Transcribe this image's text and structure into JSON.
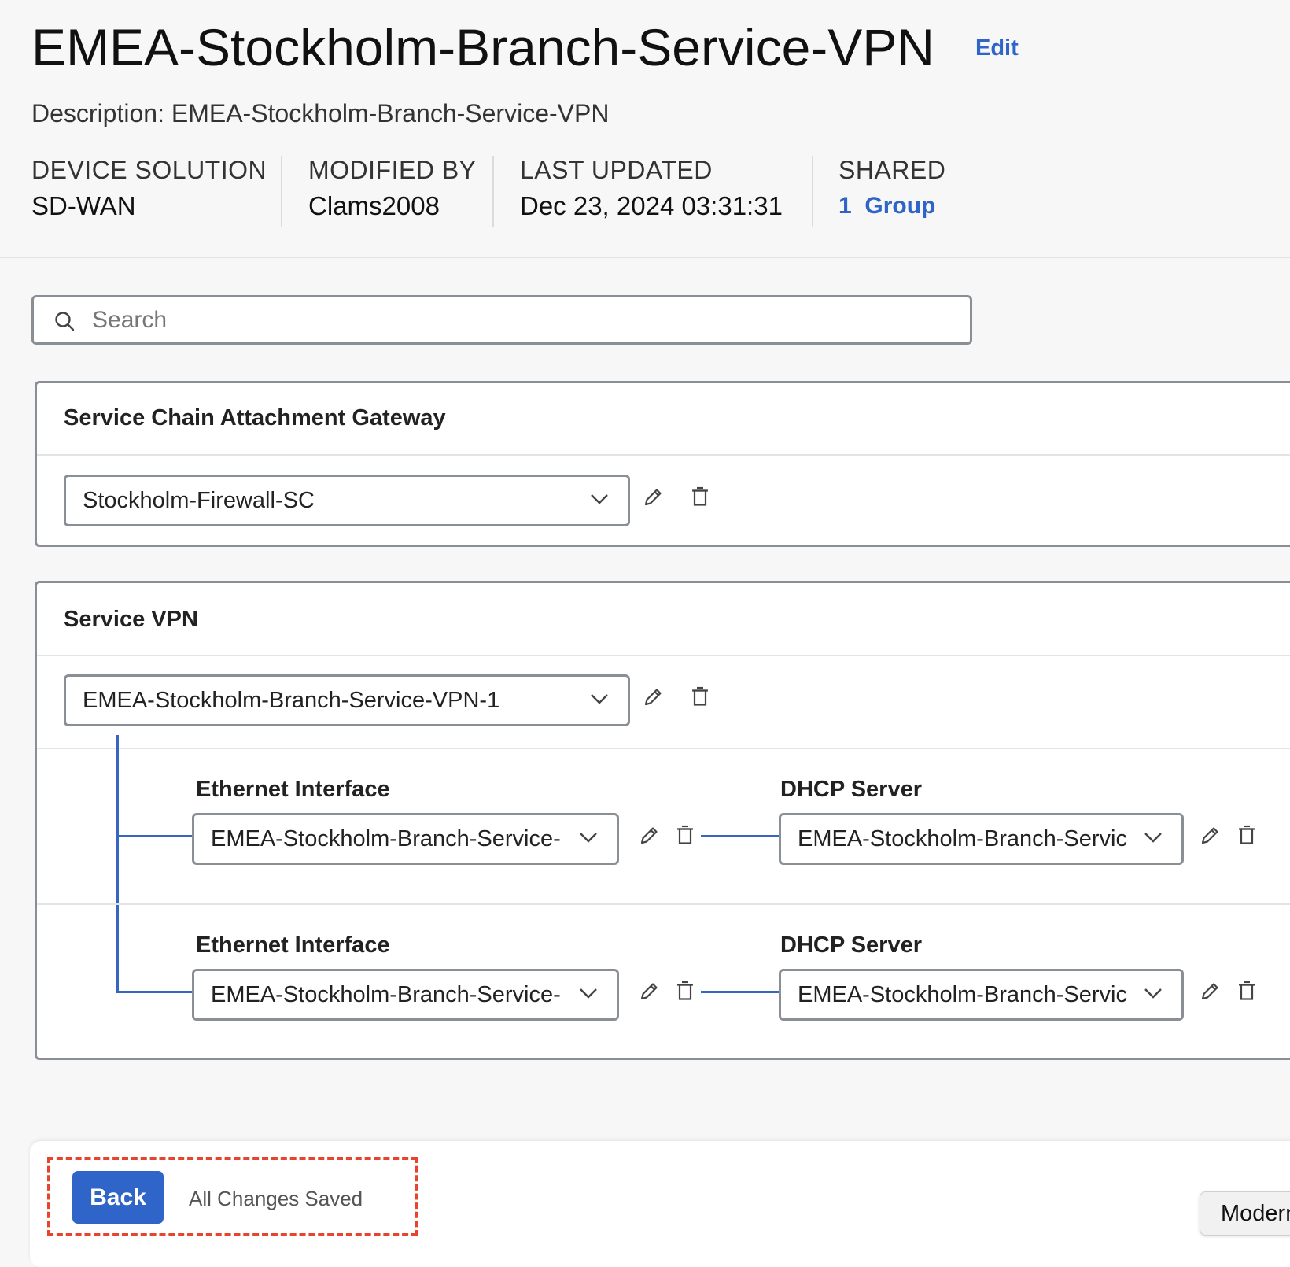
{
  "header": {
    "title": "EMEA-Stockholm-Branch-Service-VPN",
    "edit_label": "Edit",
    "description": "Description: EMEA-Stockholm-Branch-Service-VPN",
    "meta": {
      "device_solution_label": "DEVICE SOLUTION",
      "device_solution_value": "SD-WAN",
      "modified_by_label": "MODIFIED BY",
      "modified_by_value": "Clams2008",
      "last_updated_label": "LAST UPDATED",
      "last_updated_value": "Dec 23, 2024 03:31:31",
      "shared_label": "SHARED",
      "shared_value": "1  Group"
    }
  },
  "search": {
    "placeholder": "Search"
  },
  "service_chain": {
    "title": "Service Chain Attachment Gateway",
    "selected": "Stockholm-Firewall-SC"
  },
  "service_vpn": {
    "title": "Service VPN",
    "selected": "EMEA-Stockholm-Branch-Service-VPN-1",
    "rows": [
      {
        "ethernet_label": "Ethernet Interface",
        "ethernet_value": "EMEA-Stockholm-Branch-Service-",
        "dhcp_label": "DHCP Server",
        "dhcp_value": "EMEA-Stockholm-Branch-Servic"
      },
      {
        "ethernet_label": "Ethernet Interface",
        "ethernet_value": "EMEA-Stockholm-Branch-Service-",
        "dhcp_label": "DHCP Server",
        "dhcp_value": "EMEA-Stockholm-Branch-Servic"
      }
    ]
  },
  "footer": {
    "back_label": "Back",
    "status": "All Changes Saved",
    "tooltip": "Modern"
  },
  "colors": {
    "accent": "#2f64c9",
    "highlight": "#e8432c",
    "border": "#8a8f96"
  },
  "icons": [
    "search-icon",
    "chevron-down-icon",
    "pencil-icon",
    "trash-icon"
  ]
}
